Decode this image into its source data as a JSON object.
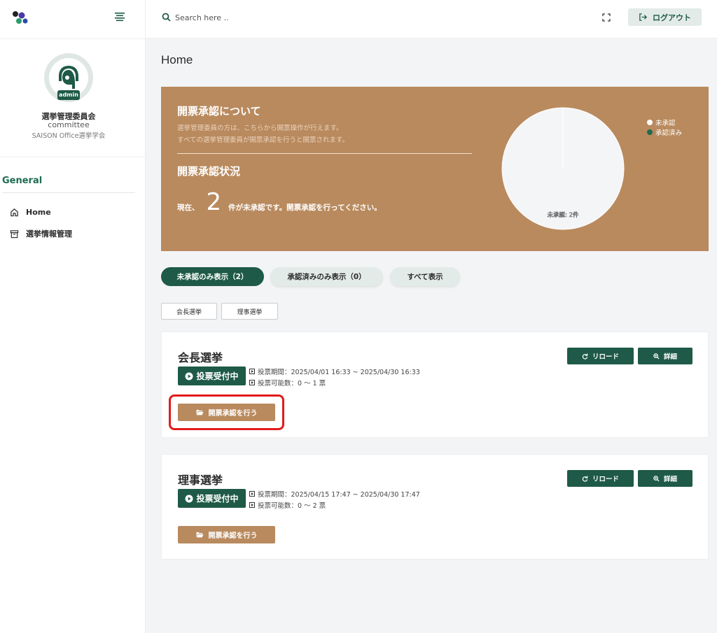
{
  "sidebar": {
    "profile": {
      "badge": "admin",
      "name": "選挙管理委員会",
      "role": "committee",
      "org": "SAISON Office選挙学会"
    },
    "section_title": "General",
    "items": [
      {
        "label": "Home",
        "icon": "home-icon"
      },
      {
        "label": "選挙情報管理",
        "icon": "archive-icon"
      }
    ]
  },
  "topbar": {
    "search_placeholder": "Search here ..",
    "logout_label": "ログアウト"
  },
  "main": {
    "page_title": "Home",
    "banner": {
      "title": "開票承認について",
      "desc1": "選挙管理委員の方は、こちらから開票操作が行えます。",
      "desc2": "すべての選挙管理委員が開票承認を行うと開票されます。",
      "status_title": "開票承認状況",
      "status_prefix": "現在、",
      "status_count": "2",
      "status_suffix": "件が未承認です。開票承認を行ってください。",
      "pie_label": "未承認: 2件"
    },
    "filters": [
      {
        "label": "未承認のみ表示（2）",
        "active": true
      },
      {
        "label": "承認済みのみ表示（0）",
        "active": false
      },
      {
        "label": "すべて表示",
        "active": false
      }
    ],
    "chips": [
      "会長選挙",
      "理事選挙"
    ],
    "elections": [
      {
        "title": "会長選挙",
        "status": "投票受付中",
        "period": "投票期間：2025/04/01 16:33 ~ 2025/04/30 16:33",
        "votes": "投票可能数：0 〜 1 票",
        "reload": "リロード",
        "detail": "詳細",
        "approve": "開票承認を行う"
      },
      {
        "title": "理事選挙",
        "status": "投票受付中",
        "period": "投票期間：2025/04/15 17:47 ~ 2025/04/30 17:47",
        "votes": "投票可能数：0 〜 2 票",
        "reload": "リロード",
        "detail": "詳細",
        "approve": "開票承認を行う"
      }
    ]
  },
  "chart_data": {
    "type": "pie",
    "categories": [
      "未承認",
      "承認済み"
    ],
    "values": [
      2,
      0
    ],
    "colors": [
      "#f4f5f6",
      "#1e6b52"
    ],
    "data_labels": [
      "未承認: 2件"
    ],
    "legend_position": "top-right"
  },
  "colors": {
    "brand_green": "#1e5a47",
    "banner_brown": "#b98a5e",
    "highlight_red": "#e21b1b"
  }
}
